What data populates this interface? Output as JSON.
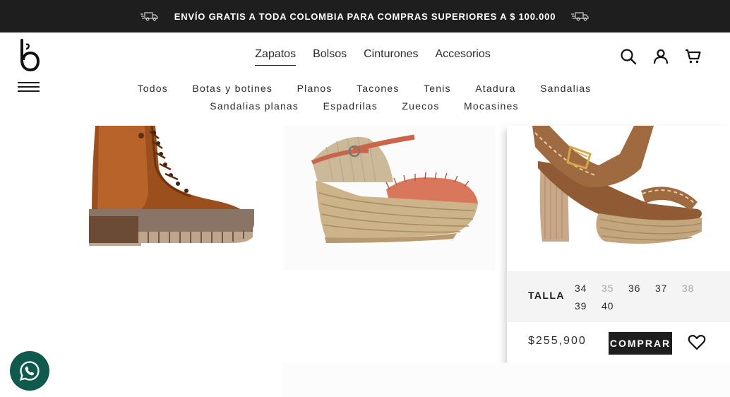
{
  "promo": {
    "text": "ENVÍO GRATIS A TODA COLOMBIA PARA COMPRAS SUPERIORES A $ 100.000",
    "icon": "truck-icon"
  },
  "brand": {
    "logo_icon": "brand-b-logo"
  },
  "main_nav": [
    {
      "label": "Zapatos",
      "active": true
    },
    {
      "label": "Bolsos"
    },
    {
      "label": "Cinturones"
    },
    {
      "label": "Accesorios"
    }
  ],
  "sub_nav": [
    {
      "label": "Todos"
    },
    {
      "label": "Botas y botines"
    },
    {
      "label": "Planos"
    },
    {
      "label": "Tacones"
    },
    {
      "label": "Tenis"
    },
    {
      "label": "Atadura"
    },
    {
      "label": "Sandalias"
    },
    {
      "label": "Sandalias planas"
    },
    {
      "label": "Espadrilas"
    },
    {
      "label": "Zuecos"
    },
    {
      "label": "Mocasines"
    }
  ],
  "header_icons": [
    "search-icon",
    "user-icon",
    "cart-icon",
    "menu-icon"
  ],
  "products": [
    {
      "image": "brown-lace-up-boot"
    },
    {
      "image": "coral-espadrille-wedge"
    },
    {
      "image": "brown-block-heel-sandal",
      "sizes_label": "TALLA",
      "sizes": [
        {
          "value": "34",
          "available": true
        },
        {
          "value": "35",
          "available": false
        },
        {
          "value": "36",
          "available": true
        },
        {
          "value": "37",
          "available": true
        },
        {
          "value": "38",
          "available": false
        },
        {
          "value": "39",
          "available": true
        },
        {
          "value": "40",
          "available": true
        }
      ],
      "price": "$255,900",
      "buy_label": "COMPRAR",
      "favorite_icon": "heart-icon"
    }
  ],
  "whatsapp": {
    "icon": "whatsapp-icon"
  },
  "colors": {
    "promo_bar": "#1e1e1e",
    "buy_button": "#1e1e1e",
    "whatsapp": "#0f5a4c",
    "size_panel": "#f4f4f4"
  }
}
